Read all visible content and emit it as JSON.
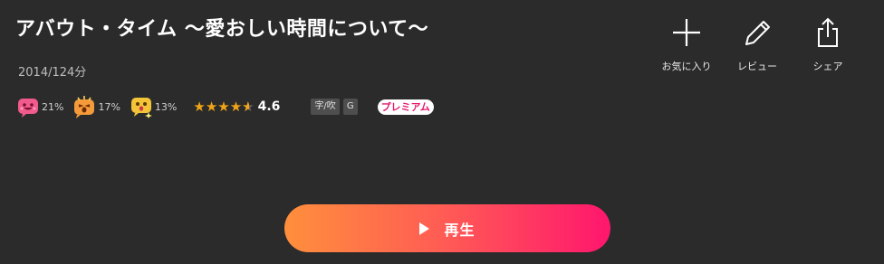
{
  "title": "アバウト・タイム 〜愛おしい時間について〜",
  "meta": "2014/124分",
  "reactions": [
    {
      "icon": "pink-smile-emoji-icon",
      "percent": "21%",
      "color": "#f05a8c"
    },
    {
      "icon": "orange-surprise-emoji-icon",
      "percent": "17%",
      "color": "#f49a3a"
    },
    {
      "icon": "yellow-shocked-emoji-icon",
      "percent": "13%",
      "color": "#f3c437"
    }
  ],
  "rating": {
    "value": 4.6,
    "label": "4.6",
    "stars_full": 4,
    "stars_half": 1
  },
  "tags": {
    "subtitle_dub": "字/吹",
    "age_rating": "G",
    "premium": "プレミアム"
  },
  "actions": {
    "favorite": "お気に入り",
    "review": "レビュー",
    "share": "シェア"
  },
  "play": {
    "label": "再生"
  },
  "colors": {
    "background": "#2b2b2b",
    "star": "#f2a418",
    "play_gradient_start": "#ff8f3c",
    "play_gradient_end": "#ff166e",
    "premium_text": "#e5186e"
  }
}
